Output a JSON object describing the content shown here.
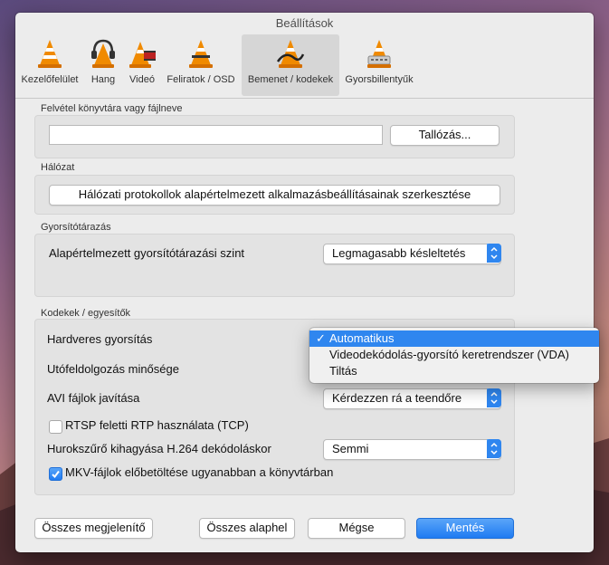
{
  "window": {
    "title": "Beállítások"
  },
  "toolbar": {
    "items": [
      {
        "label": "Kezelőfelület",
        "icon": "vlc-cone-icon"
      },
      {
        "label": "Hang",
        "icon": "headphones-cone-icon"
      },
      {
        "label": "Videó",
        "icon": "film-cone-icon"
      },
      {
        "label": "Feliratok / OSD",
        "icon": "subtitle-cone-icon"
      },
      {
        "label": "Bemenet / kodekek",
        "icon": "cable-cone-icon",
        "active": true
      },
      {
        "label": "Gyorsbillentyűk",
        "icon": "keyboard-cone-icon"
      }
    ]
  },
  "sections": {
    "record": {
      "title": "Felvétel könyvtára vagy fájlneve",
      "input_value": "",
      "browse_label": "Tallózás..."
    },
    "network": {
      "title": "Hálózat",
      "button_label": "Hálózati protokollok alapértelmezett alkalmazásbeállításainak szerkesztése"
    },
    "caching": {
      "title": "Gyorsítótárazás",
      "level_label": "Alapértelmezett gyorsítótárazási szint",
      "level_value": "Legmagasabb késleltetés"
    },
    "codecs": {
      "title": "Kodekek / egyesítők",
      "hw_label": "Hardveres gyorsítás",
      "postproc_label": "Utófeldolgozás minősége",
      "avi_label": "AVI fájlok javítása",
      "avi_value": "Kérdezzen rá a teendőre",
      "rtsp_label": "RTSP feletti RTP használata (TCP)",
      "rtsp_checked": false,
      "loop_label": "Hurokszűrő kihagyása H.264 dekódoláskor",
      "loop_value": "Semmi",
      "mkv_label": "MKV-fájlok előbetöltése ugyanabban a könyvtárban",
      "mkv_checked": true
    }
  },
  "hw_dropdown": {
    "options": [
      "Automatikus",
      "Videodekódolás-gyorsító keretrendszer (VDA)",
      "Tiltás"
    ],
    "selected": "Automatikus",
    "check": "✓"
  },
  "footer": {
    "show_all": "Összes megjelenítő",
    "reset_all": "Összes alaphel",
    "cancel": "Mégse",
    "save": "Mentés"
  },
  "colors": {
    "accent": "#2f86ef",
    "window_bg": "#ececec",
    "group_bg": "#e3e3e3"
  }
}
